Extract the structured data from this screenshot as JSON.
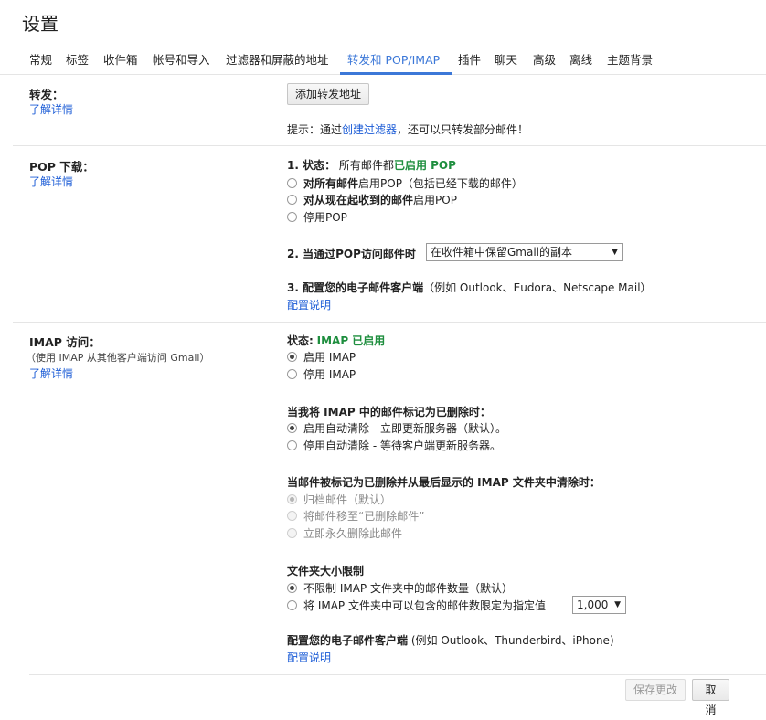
{
  "page": {
    "title": "设置"
  },
  "tabs": [
    "常规",
    "标签",
    "收件箱",
    "帐号和导入",
    "过滤器和屏蔽的地址",
    "转发和 POP/IMAP",
    "插件",
    "聊天",
    "高级",
    "离线",
    "主题背景"
  ],
  "forwarding": {
    "title": "转发：",
    "learn_more": "了解详情",
    "add_button": "添加转发地址",
    "tip_prefix": "提示：通过",
    "tip_link": "创建过滤器",
    "tip_suffix": "，还可以只转发部分邮件！"
  },
  "pop": {
    "title": "POP 下载：",
    "learn_more": "了解详情",
    "status_label": "1. 状态：",
    "status_text": "所有邮件都",
    "status_value": "已启用 POP",
    "option1_bold": "对所有邮件",
    "option1_text": "启用POP（包括已经下载的邮件）",
    "option2_bold": "对从现在起收到的邮件",
    "option2_text": "启用POP",
    "option3_text": "停用POP",
    "when_label": "2. 当通过POP访问邮件时",
    "when_select": "在收件箱中保留Gmail的副本",
    "config_label": "3. 配置您的电子邮件客户端",
    "config_text": "（例如 Outlook、Eudora、Netscape Mail）",
    "config_link": "配置说明"
  },
  "imap": {
    "title": "IMAP 访问：",
    "subtitle": "（使用 IMAP 从其他客户端访问 Gmail）",
    "learn_more": "了解详情",
    "status_label": "状态:",
    "status_value": "IMAP 已启用",
    "enable": "启用 IMAP",
    "disable": "停用 IMAP",
    "deleted_title": "当我将 IMAP 中的邮件标记为已删除时：",
    "deleted_opt1": "启用自动清除 - 立即更新服务器（默认）。",
    "deleted_opt2": "停用自动清除 - 等待客户端更新服务器。",
    "expunge_title": "当邮件被标记为已删除并从最后显示的 IMAP 文件夹中清除时：",
    "expunge_opt1": "归档邮件（默认）",
    "expunge_opt2": "将邮件移至“已删除邮件”",
    "expunge_opt3": "立即永久删除此邮件",
    "folder_title": "文件夹大小限制",
    "folder_opt1": "不限制 IMAP 文件夹中的邮件数量（默认）",
    "folder_opt2": "将 IMAP 文件夹中可以包含的邮件数限定为指定值",
    "folder_select": "1,000",
    "config_label": "配置您的电子邮件客户端",
    "config_text": "(例如 Outlook、Thunderbird、iPhone)",
    "config_link": "配置说明"
  },
  "footer": {
    "save": "保存更改",
    "cancel": "取消"
  },
  "icons": {
    "caret": "▼"
  },
  "colors": {
    "accent": "#3c78d8",
    "link": "#1a5bd6",
    "enabled": "#1e8e3e"
  }
}
